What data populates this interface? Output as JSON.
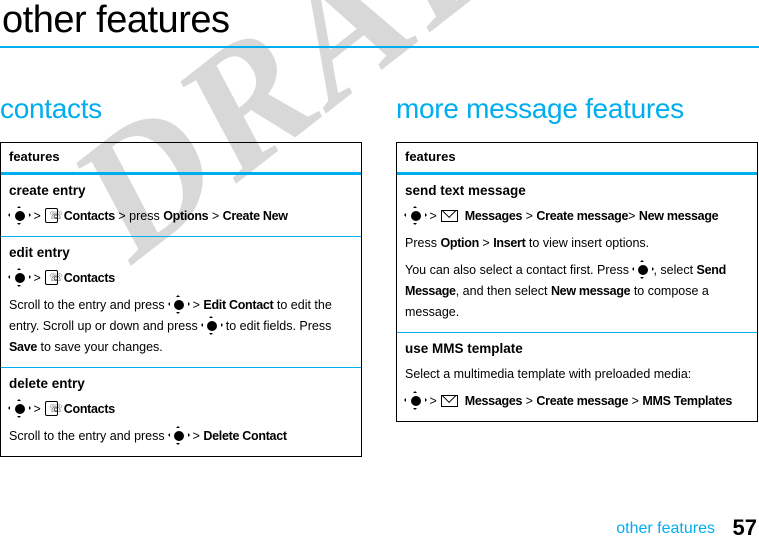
{
  "page": {
    "title": "other features",
    "accent_color": "#00AEEF",
    "watermark": "DRAFT",
    "watermark_color": "#d8d8d8"
  },
  "footer": {
    "label": "other features",
    "page_number": "57"
  },
  "icons": {
    "nav_key": "navigation-key-icon",
    "contacts": "contacts-handset-icon",
    "messages": "envelope-icon"
  },
  "left_column": {
    "heading": "contacts",
    "table": {
      "header": "features",
      "rows": [
        {
          "title": "create entry",
          "path": {
            "sep1": ">",
            "app": "Contacts",
            "sep2": ">",
            "verb": "press",
            "item1": "Options",
            "sep3": ">",
            "item2": "Create New"
          }
        },
        {
          "title": "edit entry",
          "path": {
            "sep1": ">",
            "app": "Contacts"
          },
          "body_pre": "Scroll to the entry and press",
          "body_sep": ">",
          "body_key1": "Edit Contact",
          "body_mid": "to edit the entry. Scroll up or down and press",
          "body_post": "to edit fields. Press",
          "body_key2": "Save",
          "body_end": "to save your changes."
        },
        {
          "title": "delete entry",
          "path": {
            "sep1": ">",
            "app": "Contacts"
          },
          "body_pre": "Scroll to the entry and press",
          "body_sep": ">",
          "body_key1": "Delete Contact"
        }
      ]
    }
  },
  "right_column": {
    "heading": "more message features",
    "table": {
      "header": "features",
      "rows": [
        {
          "title": "send text message",
          "path": {
            "sep1": ">",
            "app": "Messages",
            "sep2": ">",
            "item1": "Create message",
            "sep3": ">",
            "item2": "New message"
          },
          "p2_pre": "Press",
          "p2_key1": "Option",
          "p2_sep": ">",
          "p2_key2": "Insert",
          "p2_post": "to view insert options.",
          "p3_pre": "You can also select a contact first. Press",
          "p3_mid": ", select",
          "p3_key1": "Send Message",
          "p3_mid2": ", and then select",
          "p3_key2": "New message",
          "p3_post": "to compose a message."
        },
        {
          "title": "use MMS template",
          "body": "Select a multimedia template with preloaded media:",
          "path": {
            "sep1": ">",
            "app": "Messages",
            "sep2": ">",
            "item1": "Create message",
            "sep3": ">",
            "item2": "MMS Templates"
          }
        }
      ]
    }
  }
}
